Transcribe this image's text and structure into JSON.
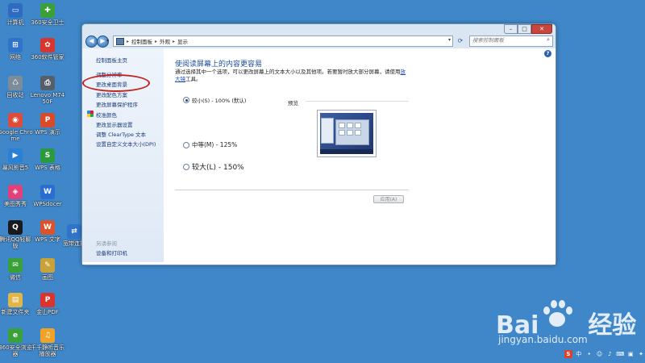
{
  "desktop": {
    "icons": [
      {
        "label": "计算机",
        "glyph": "▭",
        "color": "#2d6cc0"
      },
      {
        "label": "360安全卫士",
        "glyph": "✚",
        "color": "#3aa13a"
      },
      {
        "label": "网络",
        "glyph": "⊞",
        "color": "#2f74c9"
      },
      {
        "label": "360软件管家",
        "glyph": "✿",
        "color": "#d8352e"
      },
      {
        "label": "回收站",
        "glyph": "♺",
        "color": "#7d8c99"
      },
      {
        "label": "Lenovo M7450F",
        "glyph": "⎙",
        "color": "#555f6b"
      },
      {
        "label": "Google Chrome",
        "glyph": "◉",
        "color": "#dd4b39"
      },
      {
        "label": "WPS 演示",
        "glyph": "P",
        "color": "#d84b2a"
      },
      {
        "label": "暴风影音5",
        "glyph": "▶",
        "color": "#2a80d2"
      },
      {
        "label": "WPS 表格",
        "glyph": "S",
        "color": "#2b9a3f"
      },
      {
        "label": "美图秀秀",
        "glyph": "◈",
        "color": "#e0417a"
      },
      {
        "label": "WPSdocer",
        "glyph": "W",
        "color": "#2a6fd0"
      },
      {
        "label": "腾讯QQ轻聊版",
        "glyph": "Q",
        "color": "#1a1a1a"
      },
      {
        "label": "WPS 文字",
        "glyph": "W",
        "color": "#d9532c"
      },
      {
        "label": "宽带连接",
        "glyph": "⇄",
        "color": "#2f74c9"
      },
      {
        "label": "微信",
        "glyph": "✉",
        "color": "#3aa13a"
      },
      {
        "label": "画图",
        "glyph": "✎",
        "color": "#c9a23a"
      },
      {
        "label": "新建文件夹",
        "glyph": "▤",
        "color": "#e2b548"
      },
      {
        "label": "金山PDF",
        "glyph": "P",
        "color": "#d8352e"
      },
      {
        "label": "360安全浏览器",
        "glyph": "e",
        "color": "#3aa13a"
      },
      {
        "label": "千千静听音乐播放器",
        "glyph": "♫",
        "color": "#f0a326"
      }
    ]
  },
  "window": {
    "controls": {
      "minimize": "–",
      "maximize": "□",
      "close": "✕"
    },
    "nav": {
      "back": "◀",
      "forward": "▶",
      "dropdown": "▾"
    },
    "breadcrumb": [
      "控制面板",
      "外观",
      "显示"
    ],
    "breadcrumb_sep": "▸",
    "address_dropdown": "▾",
    "refresh": "⟳",
    "search_placeholder": "搜索控制面板",
    "search_icon": "⌕",
    "help": "?",
    "sidebar": {
      "links": [
        "控制面板主页",
        "调整分辨率",
        "更改桌面背景",
        "更改配色方案",
        "更改屏幕保护程序",
        "校准颜色",
        "更改显示器设置",
        "调整 ClearType 文本",
        "设置自定义文本大小(DPI)"
      ],
      "see_also_title": "另请参阅",
      "see_also_links": [
        "设备和打印机"
      ]
    },
    "main": {
      "title": "使阅读屏幕上的内容更容易",
      "desc_prefix": "通过选择其中一个选项，可以更改屏幕上的文本大小以及其他项。若要暂时放大部分屏幕，请使用",
      "desc_link": "放大镜",
      "desc_suffix": "工具。",
      "options": [
        {
          "label": "较小(S) - 100% (默认)",
          "selected": true
        },
        {
          "label": "中等(M) - 125%",
          "selected": false
        },
        {
          "label": "较大(L) - 150%",
          "selected": false
        }
      ],
      "preview_label": "预览",
      "apply_label": "应用(A)"
    }
  },
  "watermark": {
    "brand_left": "Bai",
    "brand_right": "经验",
    "url": "jingyan.baidu.com"
  },
  "tray": [
    "S",
    "中",
    "•",
    "☺",
    "♪",
    "⌨",
    "▣",
    "✦"
  ]
}
